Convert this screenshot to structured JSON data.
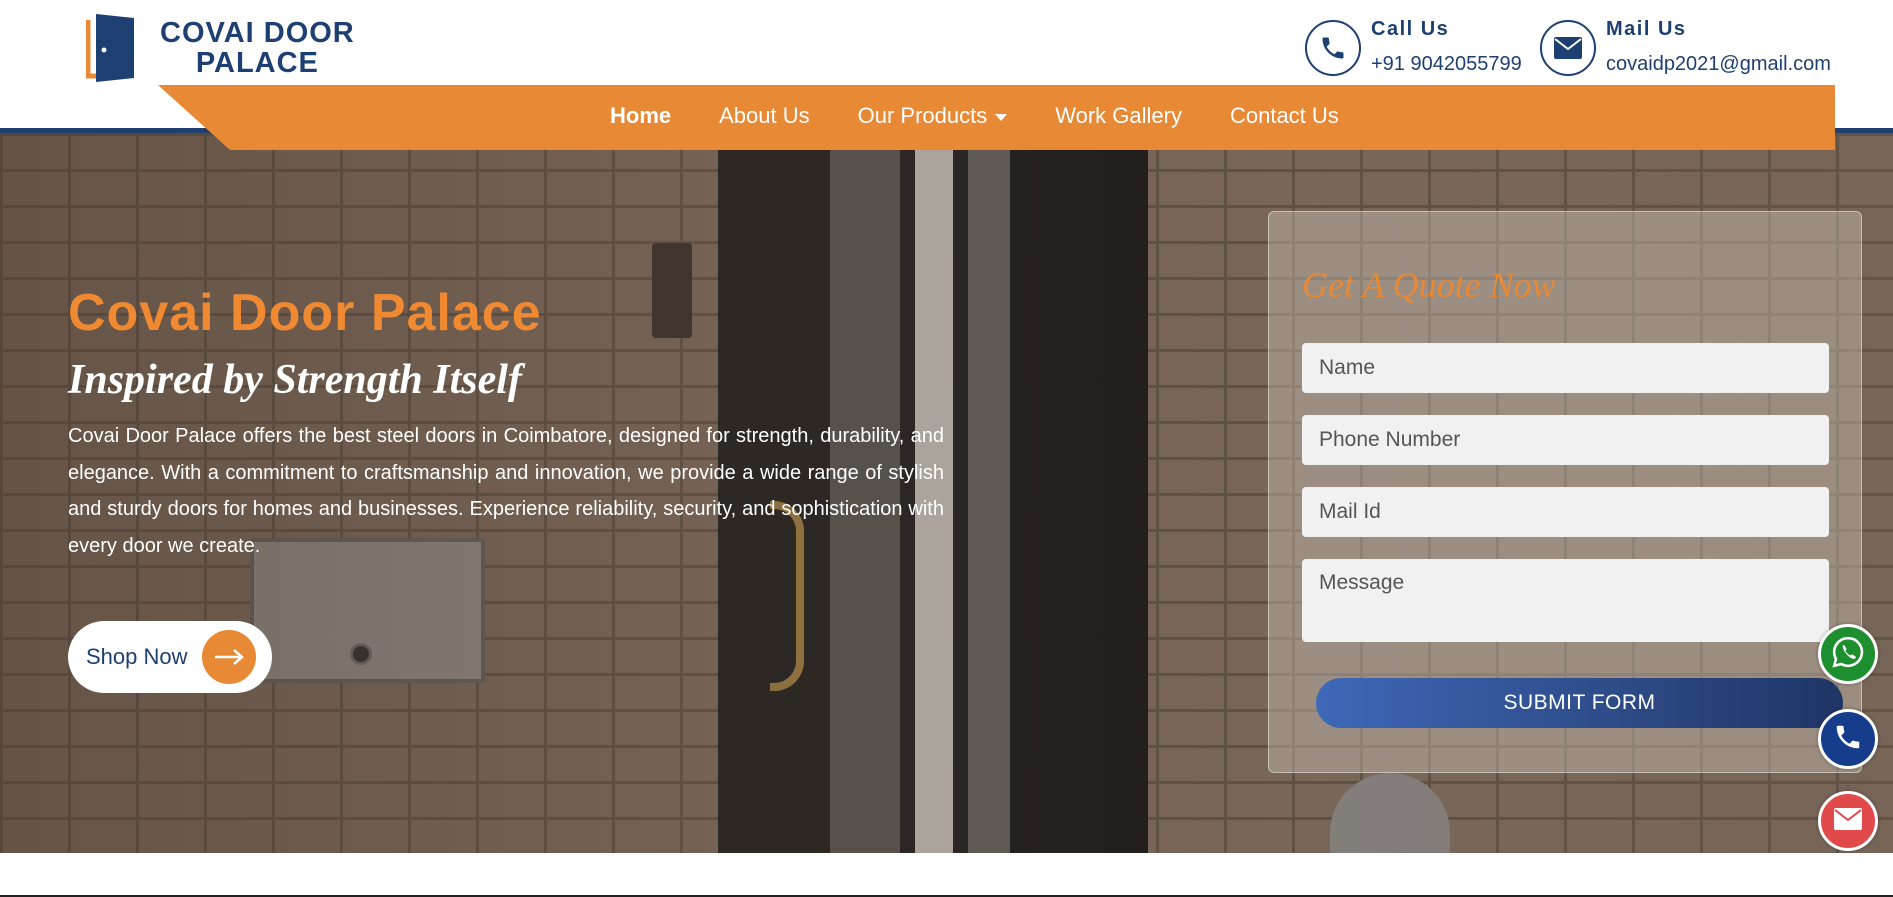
{
  "brand": {
    "line1": "COVAI DOOR",
    "line2": "PALACE"
  },
  "contact": {
    "call_title": "Call Us",
    "call_value": "+91 9042055799",
    "mail_title": "Mail Us",
    "mail_value": "covaidp2021@gmail.com"
  },
  "nav": {
    "items": [
      {
        "label": "Home"
      },
      {
        "label": "About Us"
      },
      {
        "label": "Our Products"
      },
      {
        "label": "Work Gallery"
      },
      {
        "label": "Contact Us"
      }
    ]
  },
  "hero": {
    "title": "Covai Door Palace",
    "subtitle": "Inspired by Strength Itself",
    "description": "Covai Door Palace offers the best steel doors in Coimbatore, designed for strength, durability, and elegance. With a commitment to craftsmanship and innovation, we provide a wide range of stylish and sturdy doors for homes and businesses. Experience reliability, security, and sophistication with every door we create.",
    "cta_label": "Shop Now"
  },
  "quote_form": {
    "title": "Get A Quote Now",
    "name_placeholder": "Name",
    "phone_placeholder": "Phone Number",
    "mail_placeholder": "Mail Id",
    "message_placeholder": "Message",
    "submit_label": "SUBMIT FORM"
  },
  "floating": {
    "whatsapp_icon": "whatsapp-icon",
    "phone_icon": "phone-icon",
    "email_icon": "email-icon"
  },
  "colors": {
    "brand_navy": "#1d3f72",
    "accent_orange": "#e88935",
    "whatsapp_green": "#1e8f2e",
    "email_red": "#e04a4a"
  }
}
